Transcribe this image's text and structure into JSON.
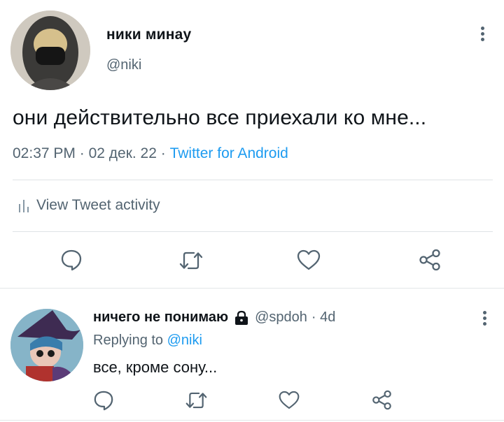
{
  "tweet": {
    "display_name": "ники минау",
    "handle": "@niki",
    "text": "они действительно все приехали ко мне...",
    "time": "02:37 PM",
    "date": "02 дек. 22",
    "separator": " · ",
    "source": "Twitter for Android",
    "activity_label": "View Tweet activity"
  },
  "reply": {
    "display_name": "ничего не понимаю",
    "handle": "@spdoh",
    "age": "· 4d",
    "replying_prefix": "Replying to ",
    "replying_to": "@niki",
    "text": "все, кроме сону..."
  },
  "colors": {
    "text": "#0f1419",
    "secondary": "#536471",
    "accent": "#1d9bf0",
    "divider": "#dfe3e6"
  },
  "icons": {
    "more": "more-vertical-icon",
    "activity": "bar-chart-icon",
    "reply": "comment-icon",
    "retweet": "retweet-icon",
    "like": "heart-icon",
    "share": "share-icon",
    "lock": "lock-icon"
  }
}
